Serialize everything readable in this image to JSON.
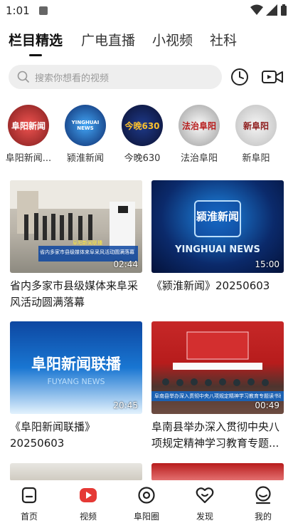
{
  "status_bar": {
    "time": "1:01"
  },
  "tabs": [
    {
      "label": "栏目精选",
      "active": true
    },
    {
      "label": "广电直播",
      "active": false
    },
    {
      "label": "小视频",
      "active": false
    },
    {
      "label": "社科",
      "active": false
    }
  ],
  "search": {
    "placeholder": "搜索你想看的视频"
  },
  "channels": [
    {
      "label": "阜阳新闻...",
      "logo_text": "阜阳新闻",
      "color": "#c62828"
    },
    {
      "label": "颍淮新闻",
      "logo_text": "YINGHUAI NEWS",
      "color": "#1565c0"
    },
    {
      "label": "今晚630",
      "logo_text": "今晚630",
      "color": "#f9a825"
    },
    {
      "label": "法治阜阳",
      "logo_text": "法治阜阳",
      "color": "#8d6e63"
    },
    {
      "label": "新阜阳",
      "logo_text": "新阜阳",
      "color": "#bdbdbd"
    }
  ],
  "videos": [
    {
      "title": "省内多家市县级媒体来阜采风活动圆满落幕",
      "duration": "02:44",
      "overlay_tag": "阜阳新闻联播",
      "overlay": "省内多家市县级媒体来阜采风活动圆满落幕"
    },
    {
      "title": "《颍淮新闻》20250603",
      "duration": "15:00",
      "overlay": "颍淮新闻",
      "overlay_sub": "YINGHUAI NEWS"
    },
    {
      "title": "《阜阳新闻联播》20250603",
      "duration": "20:45",
      "overlay": "阜阳新闻联播",
      "overlay_sub": "FUYANG NEWS"
    },
    {
      "title": "阜南县举办深入贯彻中央八项规定精神学习教育专题...",
      "duration": "00:49",
      "overlay": "阜南县举办深入贯彻中央八项规定精神学习教育专题读书班"
    }
  ],
  "bottom_nav": [
    {
      "label": "首页",
      "active": false
    },
    {
      "label": "视频",
      "active": true
    },
    {
      "label": "阜阳圈",
      "active": false
    },
    {
      "label": "发现",
      "active": false
    },
    {
      "label": "我的",
      "active": false
    }
  ],
  "colors": {
    "accent": "#e53935",
    "text": "#1a1a1a",
    "muted": "#9a9a9a",
    "search_bg": "#eeeeee"
  }
}
